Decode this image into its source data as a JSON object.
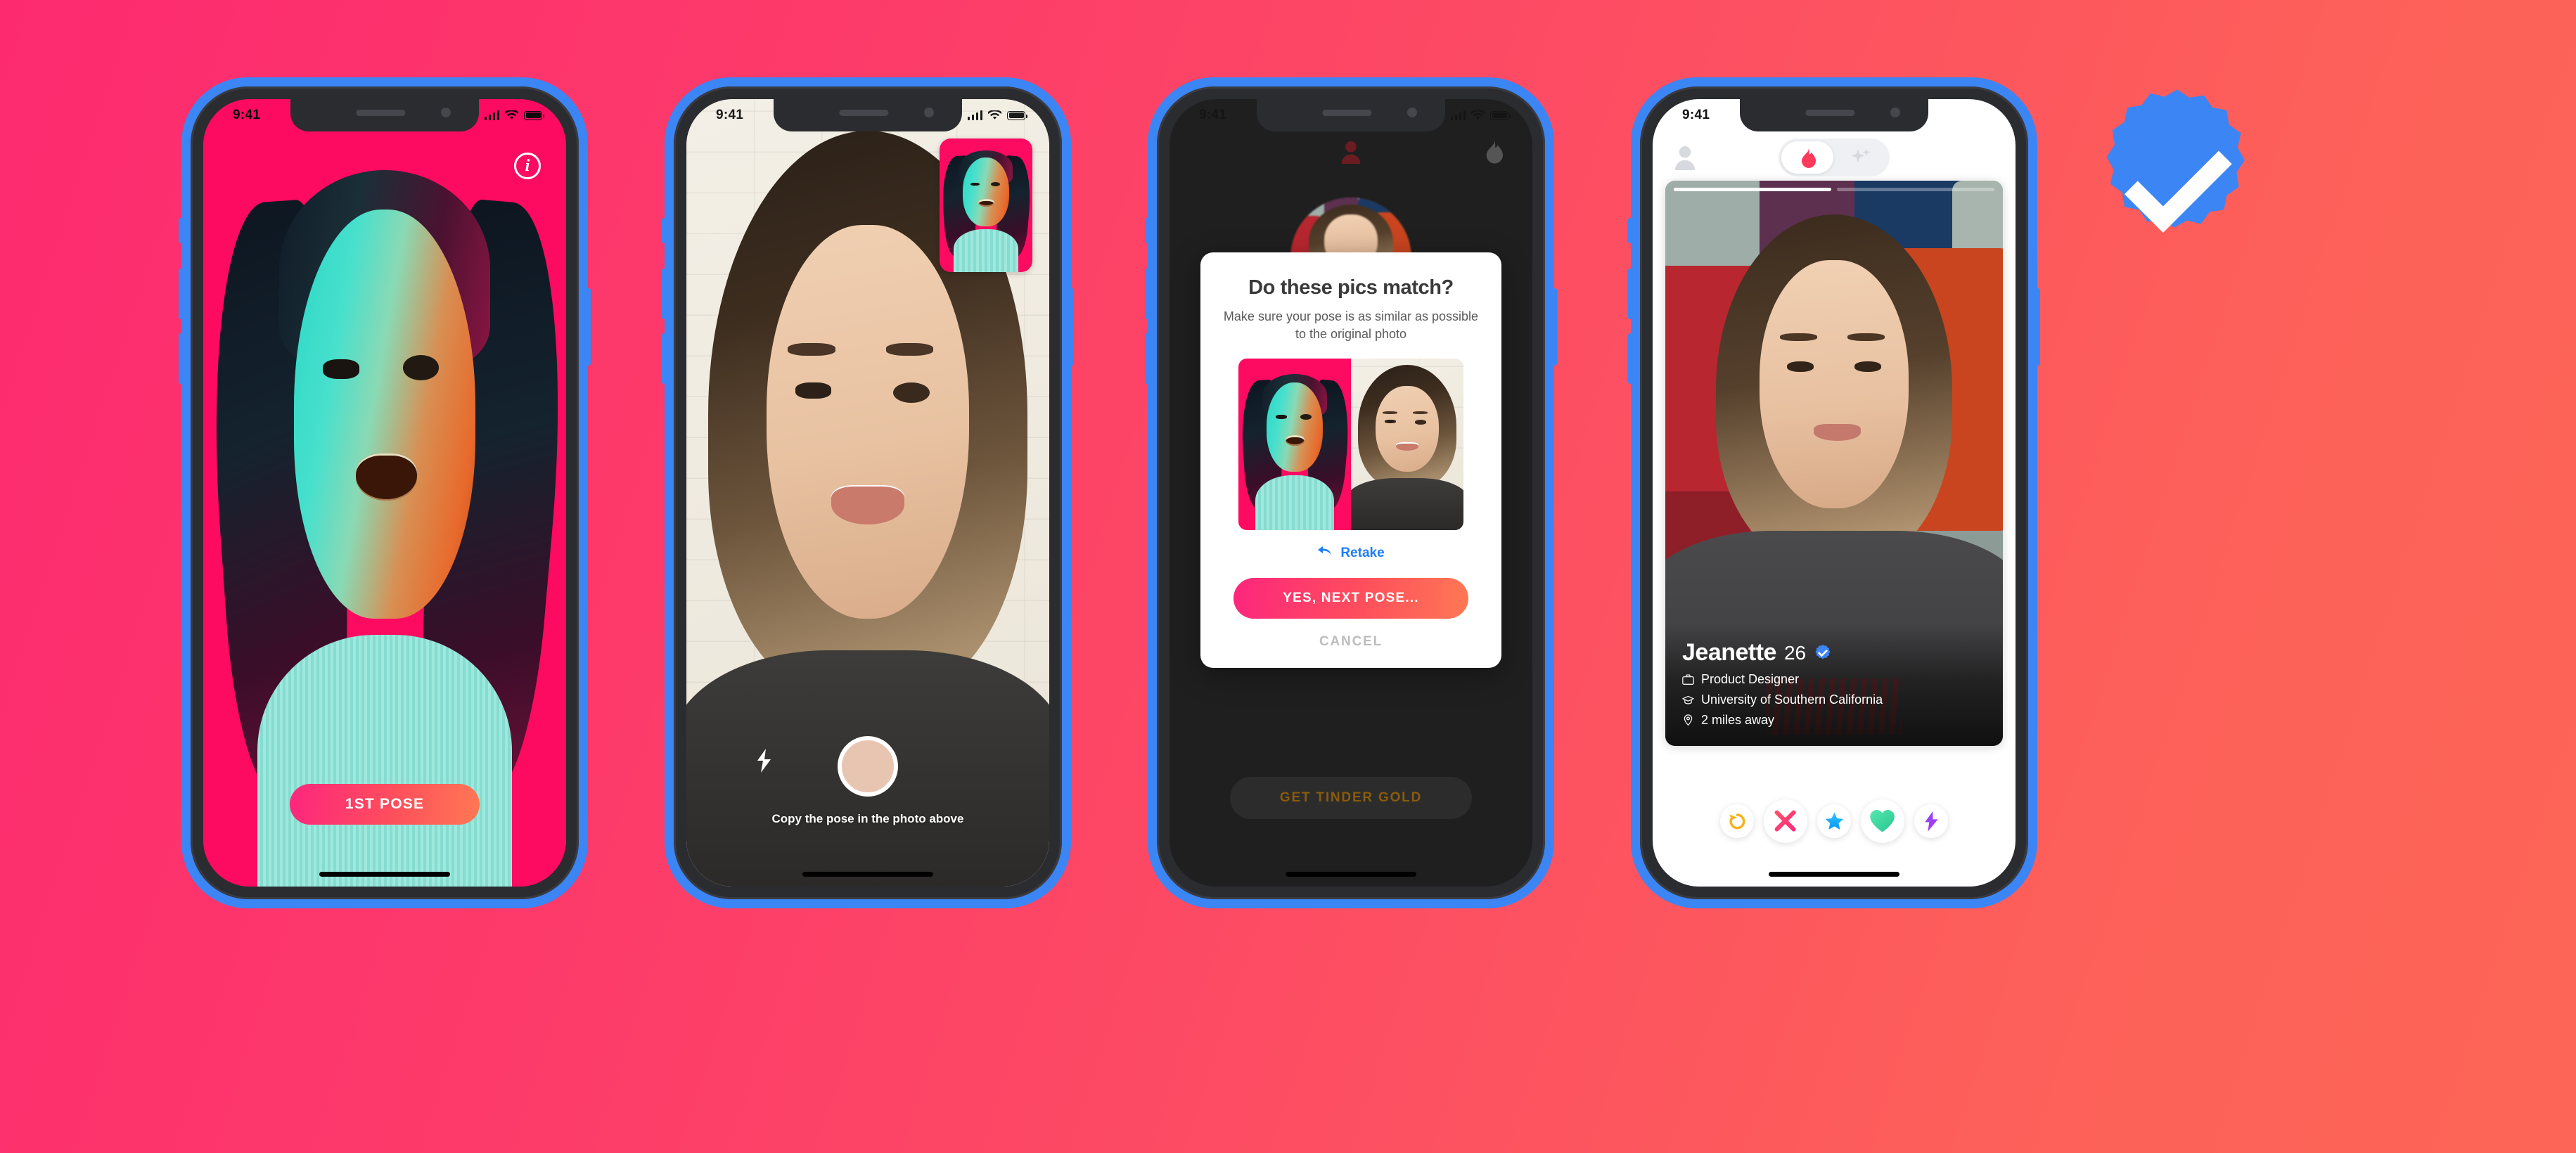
{
  "background": {
    "gradient_from": "#FD2A70",
    "gradient_to": "#FD6656"
  },
  "brand": {
    "accent_gradient_from": "#FD267D",
    "accent_gradient_to": "#FF7854",
    "verified_blue": "#3C85F5",
    "link_blue": "#1F7DF5",
    "gold": "#8A5B0C"
  },
  "status_bar": {
    "time": "9:41"
  },
  "screens": [
    {
      "id": "pose-capture",
      "name": "First pose prompt",
      "info_icon": "info-icon",
      "cta_label": "1ST POSE"
    },
    {
      "id": "camera",
      "name": "Selfie camera",
      "flash_icon": "flash-icon",
      "shutter_label": "shutter-button",
      "hint": "Copy the pose in the photo above",
      "pip_label": "reference-pose-thumbnail"
    },
    {
      "id": "confirm-modal",
      "name": "Pose match confirmation",
      "modal": {
        "title": "Do these pics match?",
        "subtitle": "Make sure your pose is as similar as possible to the original photo",
        "retake_label": "Retake",
        "primary_label": "YES, NEXT POSE...",
        "cancel_label": "CANCEL"
      },
      "background_button": "GET TINDER GOLD"
    },
    {
      "id": "discovery",
      "name": "Tinder discovery card",
      "nav": {
        "profile_icon": "person-icon",
        "toggle": [
          {
            "icon": "flame-icon",
            "label": "Discover",
            "active": true
          },
          {
            "icon": "sparkles-icon",
            "label": "Top Picks",
            "active": false
          }
        ]
      },
      "card": {
        "photo_count": 2,
        "active_photo": 1,
        "name": "Jeanette",
        "age": "26",
        "verified": true,
        "details": [
          {
            "icon": "briefcase-icon",
            "text": "Product Designer"
          },
          {
            "icon": "graduation-cap-icon",
            "text": "University of Southern California"
          },
          {
            "icon": "location-pin-icon",
            "text": "2 miles away"
          }
        ]
      },
      "actions": [
        {
          "name": "rewind",
          "icon": "rewind-icon",
          "color": "#F5B321",
          "size": "sm"
        },
        {
          "name": "nope",
          "icon": "close-x-icon",
          "color": "#FD5068",
          "size": "big"
        },
        {
          "name": "super-like",
          "icon": "star-icon",
          "color": "#21B7FF",
          "size": "sm"
        },
        {
          "name": "like",
          "icon": "heart-icon",
          "color": "#42D9A4",
          "size": "big"
        },
        {
          "name": "boost",
          "icon": "boost-bolt-icon",
          "color": "#9C37F2",
          "size": "sm"
        }
      ]
    }
  ],
  "overlay_badge": {
    "name": "verified-check-badge",
    "color": "#3C85F5"
  }
}
